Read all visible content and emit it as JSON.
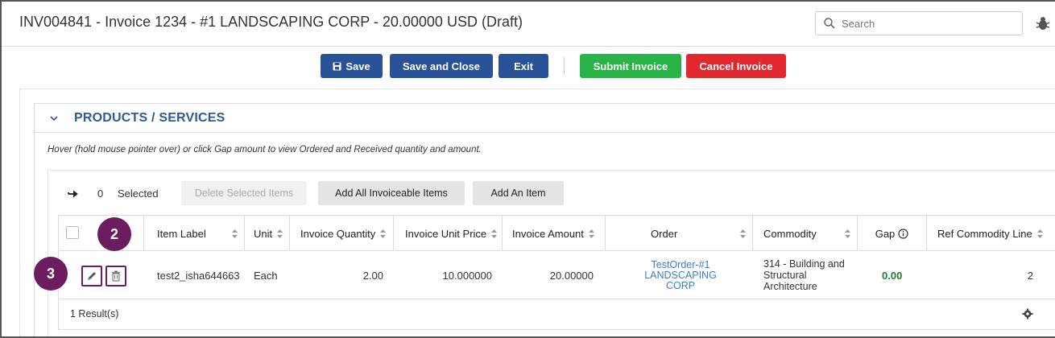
{
  "header": {
    "title": "INV004841 - Invoice 1234 - #1 LANDSCAPING CORP - 20.00000 USD (Draft)",
    "search_placeholder": "Search"
  },
  "toolbar": {
    "save_label": "Save",
    "save_close_label": "Save and Close",
    "exit_label": "Exit",
    "submit_label": "Submit Invoice",
    "cancel_label": "Cancel Invoice"
  },
  "section": {
    "title": "PRODUCTS / SERVICES",
    "hint": "Hover (hold mouse pointer over) or click Gap amount to view Ordered and Received quantity and amount."
  },
  "grid_toolbar": {
    "selected_count": "0",
    "selected_label": "Selected",
    "delete_selected_label": "Delete Selected Items",
    "add_all_label": "Add All Invoiceable Items",
    "add_item_label": "Add An Item"
  },
  "table": {
    "columns": {
      "item_label": "Item Label",
      "unit": "Unit",
      "invoice_quantity": "Invoice Quantity",
      "invoice_unit_price": "Invoice Unit Price",
      "invoice_amount": "Invoice Amount",
      "order": "Order",
      "commodity": "Commodity",
      "gap": "Gap",
      "ref_commodity_line": "Ref Commodity Line"
    },
    "rows": [
      {
        "item_label": "test2_isha644663",
        "unit": "Each",
        "invoice_quantity": "2.00",
        "invoice_unit_price": "10.000000",
        "invoice_amount": "20.00000",
        "order": "TestOrder-#1 LANDSCAPING CORP",
        "commodity": "314 - Building and Structural Architecture",
        "gap": "0.00",
        "ref_commodity_line": "2"
      }
    ],
    "results": "1 Result(s)"
  },
  "callouts": {
    "step_2": "2",
    "step_3": "3"
  },
  "colors": {
    "primary_blue": "#2a5298",
    "submit_green": "#28b446",
    "cancel_red": "#e0282e",
    "section_title": "#2e5a93",
    "callout_purple": "#6d1c5f",
    "link_blue": "#3a7dc9",
    "gap_green": "#1a7d2e"
  }
}
